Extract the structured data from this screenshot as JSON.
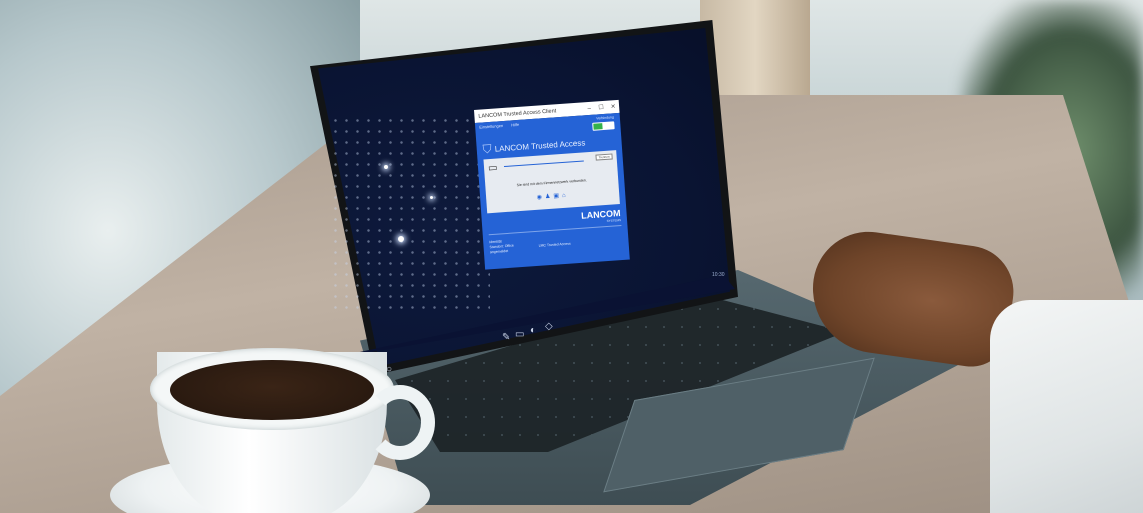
{
  "app": {
    "window_title": "LANCOM Trusted Access Client",
    "window_controls": {
      "minimize": "–",
      "maximize": "☐",
      "close": "✕"
    },
    "menu": [
      "Einstellungen",
      "Hilfe"
    ],
    "toggle_label": "Verbindung",
    "brand_name": "LANCOM Trusted Access",
    "connect_button": "Trennen",
    "connection_status": "Sie sind mit dem Firmennetzwerk verbunden.",
    "status_icons": [
      "globe-icon",
      "user-icon",
      "lock-icon",
      "network-icon"
    ],
    "logo_main": "LANCOM",
    "logo_sub": "SYSTEMS",
    "footer": {
      "col1": [
        "Identität",
        "Standort: Office",
        "angemeldet"
      ],
      "col2_label": "LMC Trusted Access"
    },
    "colors": {
      "primary": "#2563d6",
      "toggle_on": "#34b14a"
    }
  },
  "taskbar": {
    "left_icons": [
      "windows-icon",
      "search-icon"
    ],
    "center_icons": [
      "pen-icon",
      "task-view-icon",
      "edge-icon",
      "security-icon"
    ],
    "tray_time": "10:30"
  }
}
